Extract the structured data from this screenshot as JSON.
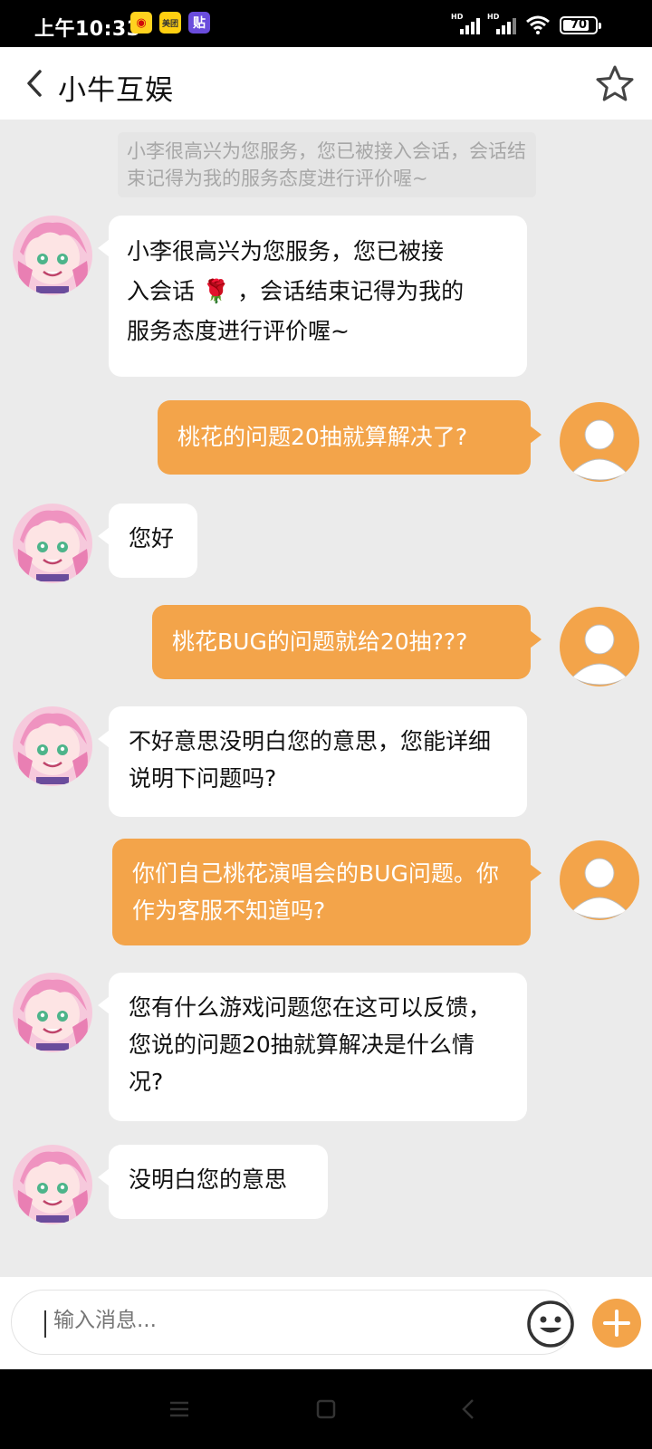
{
  "status_bar": {
    "time": "上午10:33",
    "apps": [
      "weibo-icon",
      "meituan-icon",
      "tieba-icon"
    ],
    "meituan_label": "美团",
    "tie_label": "贴",
    "signal_label": "HD",
    "battery": "70"
  },
  "header": {
    "title": "小牛互娱"
  },
  "chat": {
    "system_note": "小李很高兴为您服务，您已被接入会话，会话结束记得为我的服务态度进行评价喔~",
    "messages": [
      {
        "from": "agent",
        "line1": "小李很高兴为您服务，您已被接",
        "line2_pre": "入会话",
        "emoji": "🌹",
        "line2_post": "，会话结束记得为我的",
        "line3": "服务态度进行评价喔~"
      },
      {
        "from": "user",
        "text": "桃花的问题20抽就算解决了?"
      },
      {
        "from": "agent",
        "text": "您好"
      },
      {
        "from": "user",
        "text": "桃花BUG的问题就给20抽???"
      },
      {
        "from": "agent",
        "text": "不好意思没明白您的意思，您能详细说明下问题吗?"
      },
      {
        "from": "user",
        "text": "你们自己桃花演唱会的BUG问题。你作为客服不知道吗?"
      },
      {
        "from": "agent",
        "text": "您有什么游戏问题您在这可以反馈，您说的问题20抽就算解决是什么情况?"
      },
      {
        "from": "agent",
        "text": "没明白您的意思"
      }
    ]
  },
  "input": {
    "placeholder": "输入消息..."
  },
  "colors": {
    "accent": "#f3a44a",
    "background": "#ebebeb",
    "bubble_in": "#ffffff"
  }
}
